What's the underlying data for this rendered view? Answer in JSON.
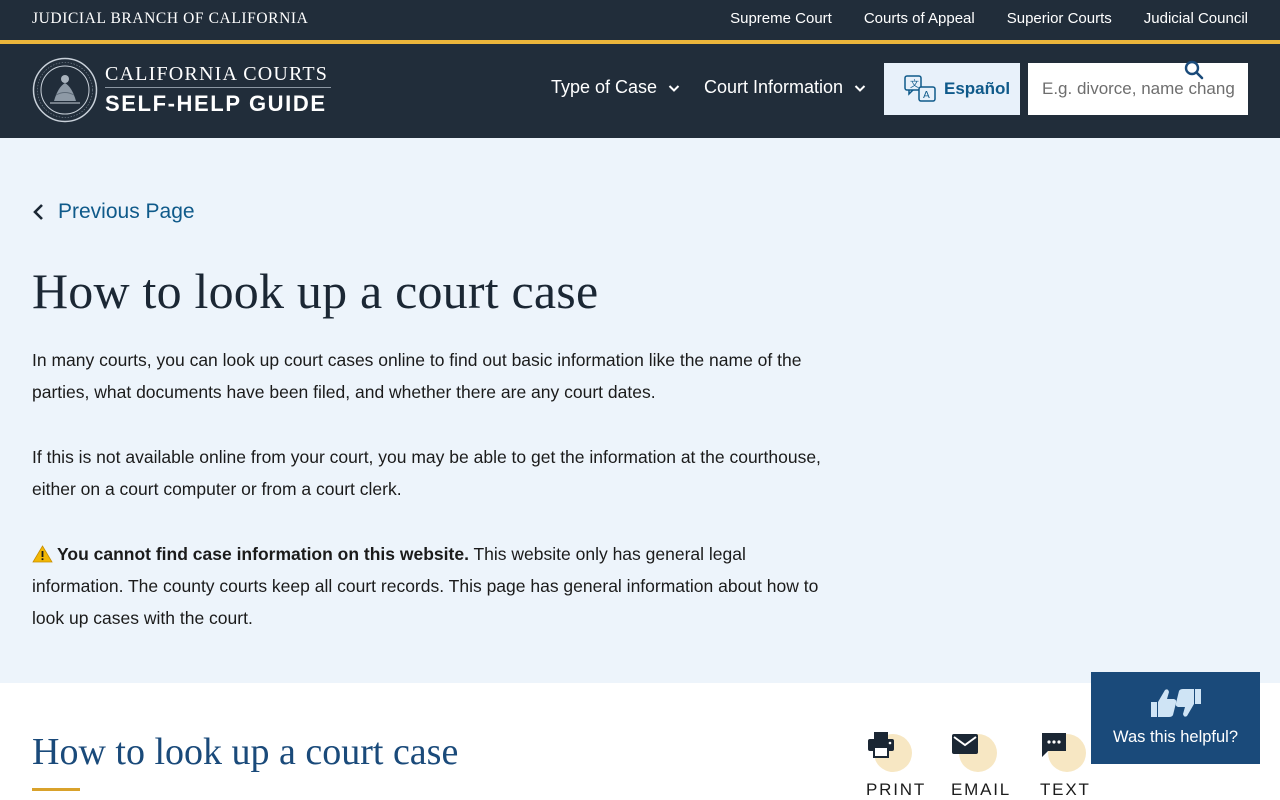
{
  "utility_bar": {
    "brand": "JUDICIAL BRANCH OF CALIFORNIA",
    "links": [
      "Supreme Court",
      "Courts of Appeal",
      "Superior Courts",
      "Judicial Council"
    ]
  },
  "header": {
    "logo_line1": "CALIFORNIA COURTS",
    "logo_line2": "SELF-HELP GUIDE",
    "nav": [
      "Type of Case",
      "Court Information"
    ],
    "language_button": "Español",
    "search_placeholder": "E.g. divorce, name change, eviction"
  },
  "hero": {
    "back_link": "Previous Page",
    "title": "How to look up a court case",
    "paragraph1": "In many courts, you can look up court cases online to find out basic information like the name of the parties, what documents have been filed, and whether there are any court dates.",
    "paragraph2": "If this is not available online from your court, you may be able to get the information at the courthouse, either on a court computer or from a court clerk.",
    "warning_bold": "You cannot find case information on this website.",
    "warning_rest": " This website only has general legal information. The county courts keep all court records. This page has general information about how to look up cases with the court."
  },
  "section": {
    "title": "How to look up a court case"
  },
  "share": {
    "print": "PRINT",
    "email": "EMAIL",
    "text": "TEXT"
  },
  "feedback": {
    "label": "Was this helpful?"
  },
  "colors": {
    "header_bg": "#212d3a",
    "accent_gold": "#ebb53b",
    "hero_bg": "#edf4fb",
    "link_blue": "#0f5a8a",
    "feedback_bg": "#1a4a7a"
  },
  "icons": [
    "seal-logo",
    "chevron-down-icon",
    "translate-icon",
    "search-icon",
    "chevron-left-icon",
    "warning-icon",
    "print-icon",
    "email-icon",
    "text-message-icon",
    "thumbs-up-icon",
    "thumbs-down-icon"
  ]
}
